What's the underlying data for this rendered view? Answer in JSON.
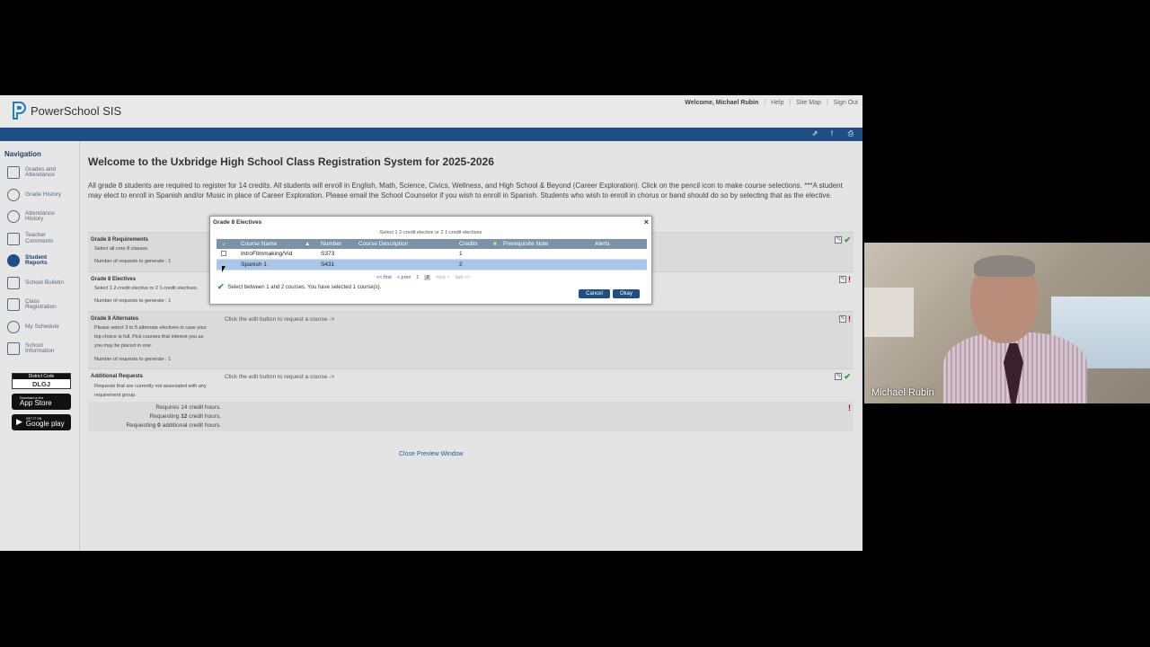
{
  "app": {
    "name": "PowerSchool SIS"
  },
  "toplinks": {
    "welcome": "Welcome, Michael Rubin",
    "help": "Help",
    "sitemap": "Site Map",
    "signout": "Sign Out"
  },
  "nav": {
    "title": "Navigation",
    "items": [
      {
        "l1": "Grades and",
        "l2": "Attendance",
        "icon": "grades-icon"
      },
      {
        "l1": "Grade History",
        "l2": "",
        "icon": "grade-history-icon"
      },
      {
        "l1": "Attendance",
        "l2": "History",
        "icon": "attendance-history-icon"
      },
      {
        "l1": "Teacher",
        "l2": "Comments",
        "icon": "teacher-comments-icon"
      },
      {
        "l1": "Student",
        "l2": "Reports",
        "icon": "student-reports-icon"
      },
      {
        "l1": "School Bulletin",
        "l2": "",
        "icon": "school-bulletin-icon"
      },
      {
        "l1": "Class",
        "l2": "Registration",
        "icon": "class-registration-icon"
      },
      {
        "l1": "My Schedule",
        "l2": "",
        "icon": "my-schedule-icon"
      },
      {
        "l1": "School",
        "l2": "Information",
        "icon": "school-information-icon"
      }
    ],
    "district_label": "District Code",
    "district_code": "DLGJ",
    "appstore_small": "Download on the",
    "appstore_big": "App Store",
    "google_small": "GET IT ON",
    "google_big": "Google play"
  },
  "main": {
    "title": "Welcome to the Uxbridge High School Class Registration System for 2025-2026",
    "intro": "All grade 8 students are required to register for 14 credits. All students will enroll in English, Math, Science, Civics, Wellness, and High School & Beyond (Career Exploration). Click on the pencil icon to make course selections. ***A student may elect to enroll in Spanish and/or Music in place of Career Exploration. Please email the School Counselor if you wish to enroll in Spanish. Students who wish to enroll in chorus or band should do so by selecting that as the elective.",
    "requirements": [
      {
        "title": "Grade 8 Requirements",
        "desc1": "Select all core 8 classes.",
        "desc2": "",
        "desc3": "",
        "count": "Number of requests to generate : 1",
        "edit": ""
      },
      {
        "title": "Grade 8 Electives",
        "desc1": "Select 1 2-credit elective or 2 1-credit electives.",
        "desc2": "",
        "desc3": "",
        "count": "Number of requests to generate : 1",
        "edit": ""
      },
      {
        "title": "Grade 8 Alternates",
        "desc1": "Please select 3 to 5 alternate electives in case your",
        "desc2": "top choice is full. Pick courses that interest you as",
        "desc3": "you may be placed in one.",
        "count": "Number of requests to generate : 1",
        "edit": "Click the edit button to request a course ->"
      },
      {
        "title": "Additional Requests",
        "desc1": "Requests that are currently not associated with any",
        "desc2": "requirement group.",
        "desc3": "",
        "count": "",
        "edit": "Click the edit button to request a course ->"
      }
    ],
    "summary": {
      "l1": "Requires 14 credit hours.",
      "l2a": "Requesting ",
      "l2b": "12",
      "l2c": " credit hours.",
      "l3a": "Requesting ",
      "l3b": "0",
      "l3c": " additional credit hours."
    },
    "close": "Close Preview Window"
  },
  "modal": {
    "title": "Grade 8 Electives",
    "subtitle": "Select 1 2-credit elective or 2 1-credit electives",
    "headers": {
      "name": "Course Name",
      "number": "Number",
      "desc": "Course Description",
      "credits": "Credits",
      "prereq": "Prerequisite Note",
      "alerts": "Alerts"
    },
    "rows": [
      {
        "name": "IntroFilmmaking/Vid",
        "number": "S373",
        "desc": "",
        "credits": "1",
        "prereq": "",
        "alerts": ""
      },
      {
        "name": "Spanish 1",
        "number": "S431",
        "desc": "",
        "credits": "2",
        "prereq": "",
        "alerts": ""
      }
    ],
    "pager": {
      "first": "<< first",
      "prev": "< prev",
      "p1": "1",
      "p2": "2",
      "next": "next >",
      "last": "last >>"
    },
    "status": "Select between 1 and 2 courses.  You have selected 1 course(s).",
    "cancel": "Cancel",
    "okay": "Okay"
  },
  "participant": {
    "name": "Michael Rubin"
  }
}
